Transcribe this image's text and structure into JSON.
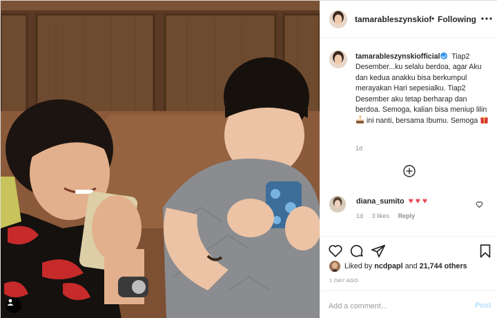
{
  "post": {
    "author": "tamarableszynskiofficial",
    "follow_dot": "•",
    "follow_label": "Following",
    "caption_user": "tamarableszynskiofficial",
    "caption_text_1": "Tiap2 Desember...ku selalu berdoa, agar Aku dan kedua anakku bisa berkumpul merayakan Hari sepesialku. Tiap2 Desember aku tetap berharap dan berdoa. Semoga, kalian bisa meniup lilin",
    "caption_text_2": "ini nanti, bersama Ibumu. Semoga",
    "caption_time": "1d",
    "caption_emojis": [
      "birthday-cake-emoji",
      "wrapped-gift-emoji"
    ]
  },
  "comments": [
    {
      "user": "diana_sumito",
      "hearts": [
        "♥",
        "♥",
        "♥"
      ],
      "time": "1d",
      "likes": "3 likes",
      "reply": "Reply"
    }
  ],
  "engagement": {
    "liked_prefix": "Liked by",
    "liked_user": "ncdpapl",
    "liked_and": "and",
    "liked_count": "21,744 others",
    "post_time": "1 DAY AGO"
  },
  "add_comment": {
    "placeholder": "Add a comment...",
    "post_label": "Post"
  },
  "icons": {
    "actions": [
      "heart-icon",
      "comment-icon",
      "share-icon",
      "bookmark-icon"
    ],
    "load_more": "plus-circle-icon",
    "more": "ellipsis-icon",
    "tag": "user-tag-icon"
  },
  "colors": {
    "verified": "#3897f0",
    "heart": "#ed4956",
    "post_button": "#b2dffc",
    "muted_text": "#8e8e8e"
  }
}
